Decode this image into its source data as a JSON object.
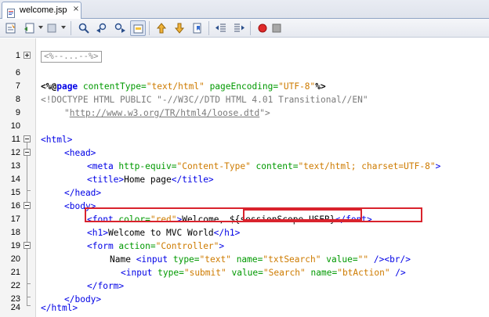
{
  "tab": {
    "title": "welcome.jsp",
    "close_glyph": "×",
    "icon": "jsp-file-icon"
  },
  "toolbar": {
    "buttons": [
      {
        "name": "last-edit-icon"
      },
      {
        "name": "back-icon"
      },
      {
        "name": "forward-icon"
      },
      {
        "name": "find-selection-icon"
      },
      {
        "name": "find-previous-icon"
      },
      {
        "name": "find-next-icon"
      },
      {
        "name": "toggle-highlight-icon"
      },
      {
        "name": "previous-bookmark-icon"
      },
      {
        "name": "next-bookmark-icon"
      },
      {
        "name": "toggle-bookmark-icon"
      },
      {
        "name": "shift-left-icon"
      },
      {
        "name": "shift-right-icon"
      },
      {
        "name": "record-macro-icon"
      },
      {
        "name": "stop-macro-icon"
      }
    ]
  },
  "editor": {
    "lines": [
      {
        "num": "1",
        "collapsed": "<%--...--%>"
      },
      {
        "num": "6"
      },
      {
        "num": "7",
        "t": [
          "<%@",
          "page",
          " contentType=",
          "\"text/html\"",
          " pageEncoding=",
          "\"UTF-8\"",
          "%>"
        ]
      },
      {
        "num": "8",
        "t": [
          "<!DOCTYPE HTML PUBLIC \"-//W3C//DTD HTML 4.01 Transitional//EN\""
        ]
      },
      {
        "num": "9",
        "t": [
          "\"",
          "http://www.w3.org/TR/html4/loose.dtd",
          "\">"
        ]
      },
      {
        "num": "10"
      },
      {
        "num": "11",
        "t": [
          "<html>"
        ]
      },
      {
        "num": "12",
        "t": [
          "<head>"
        ]
      },
      {
        "num": "13",
        "t": [
          "<meta",
          " http-equiv=",
          "\"Content-Type\"",
          " content=",
          "\"text/html; charset=UTF-8\"",
          ">"
        ]
      },
      {
        "num": "14",
        "t": [
          "<title>",
          "Home page",
          "</title>"
        ]
      },
      {
        "num": "15",
        "t": [
          "</head>"
        ]
      },
      {
        "num": "16",
        "t": [
          "<body>"
        ]
      },
      {
        "num": "17",
        "t": [
          "<font",
          " color=",
          "\"red\"",
          ">",
          "Welcome, ",
          "${sessionScope.USER}",
          "</font>"
        ]
      },
      {
        "num": "18",
        "t": [
          "<h1>",
          "Welcome to MVC World",
          "</h1>"
        ]
      },
      {
        "num": "19",
        "t": [
          "<form",
          " action=",
          "\"Controller\"",
          ">"
        ]
      },
      {
        "num": "20",
        "t": [
          "Name ",
          "<input",
          " type=",
          "\"text\"",
          " name=",
          "\"txtSearch\"",
          " value=",
          "\"\"",
          " />",
          "<br/>"
        ]
      },
      {
        "num": "21",
        "t": [
          "<input",
          " type=",
          "\"submit\"",
          " value=",
          "\"Search\"",
          " name=",
          "\"btAction\"",
          " />"
        ]
      },
      {
        "num": "22",
        "t": [
          "</form>"
        ]
      },
      {
        "num": "23",
        "t": [
          "</body>"
        ]
      },
      {
        "num": "24",
        "t": [
          "</html>"
        ]
      }
    ]
  },
  "colors": {
    "tag": "#0000e6",
    "attribute": "#009900",
    "string": "#ce7b00",
    "comment": "#8a8a8a",
    "highlight_box": "#d9232d"
  }
}
